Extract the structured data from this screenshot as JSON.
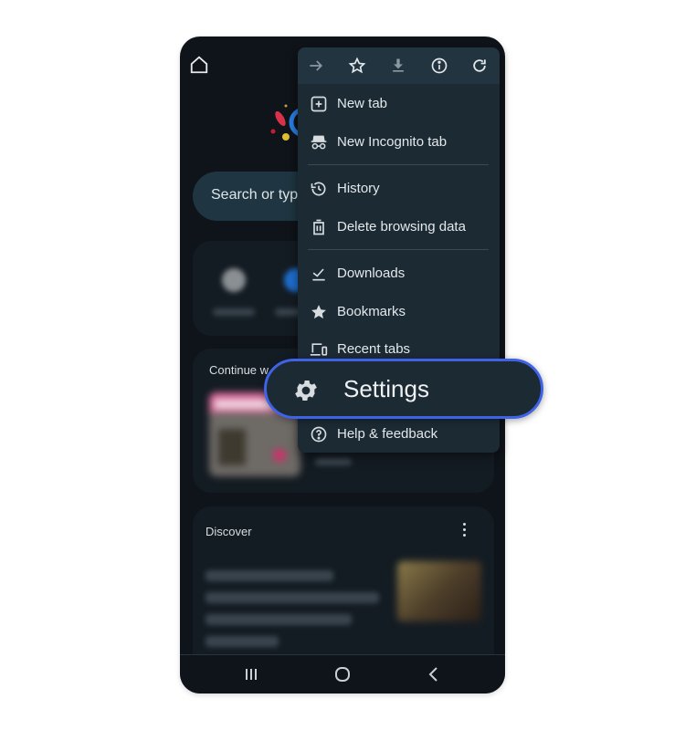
{
  "browser": {
    "home_icon": "home-icon",
    "search_placeholder": "Search or typ",
    "continue_section": {
      "title": "Continue w"
    },
    "discover_section": {
      "title": "Discover",
      "more_icon": "more-vert-icon"
    }
  },
  "menu": {
    "toolbar": [
      {
        "icon": "forward-arrow-icon",
        "label": "Forward"
      },
      {
        "icon": "star-outline-icon",
        "label": "Bookmark"
      },
      {
        "icon": "download-icon",
        "label": "Download"
      },
      {
        "icon": "info-icon",
        "label": "Page info"
      },
      {
        "icon": "refresh-icon",
        "label": "Reload"
      }
    ],
    "items": [
      {
        "icon": "new-tab-icon",
        "label": "New tab"
      },
      {
        "icon": "incognito-icon",
        "label": "New Incognito tab"
      },
      {
        "icon": "history-icon",
        "label": "History"
      },
      {
        "icon": "trash-icon",
        "label": "Delete browsing data"
      },
      {
        "icon": "downloads-check-icon",
        "label": "Downloads"
      },
      {
        "icon": "star-icon",
        "label": "Bookmarks"
      },
      {
        "icon": "devices-icon",
        "label": "Recent tabs"
      },
      {
        "icon": "gear-icon",
        "label": "Settings",
        "highlighted": true
      },
      {
        "icon": "help-icon",
        "label": "Help & feedback"
      }
    ]
  },
  "navbar": {
    "recents_icon": "recent-apps-icon",
    "home_icon": "home-circle-icon",
    "back_icon": "back-chevron-icon"
  },
  "colors": {
    "highlight_border": "#3f63e6",
    "menu_bg": "#1c2a34",
    "screen_bg": "#0f141a"
  }
}
